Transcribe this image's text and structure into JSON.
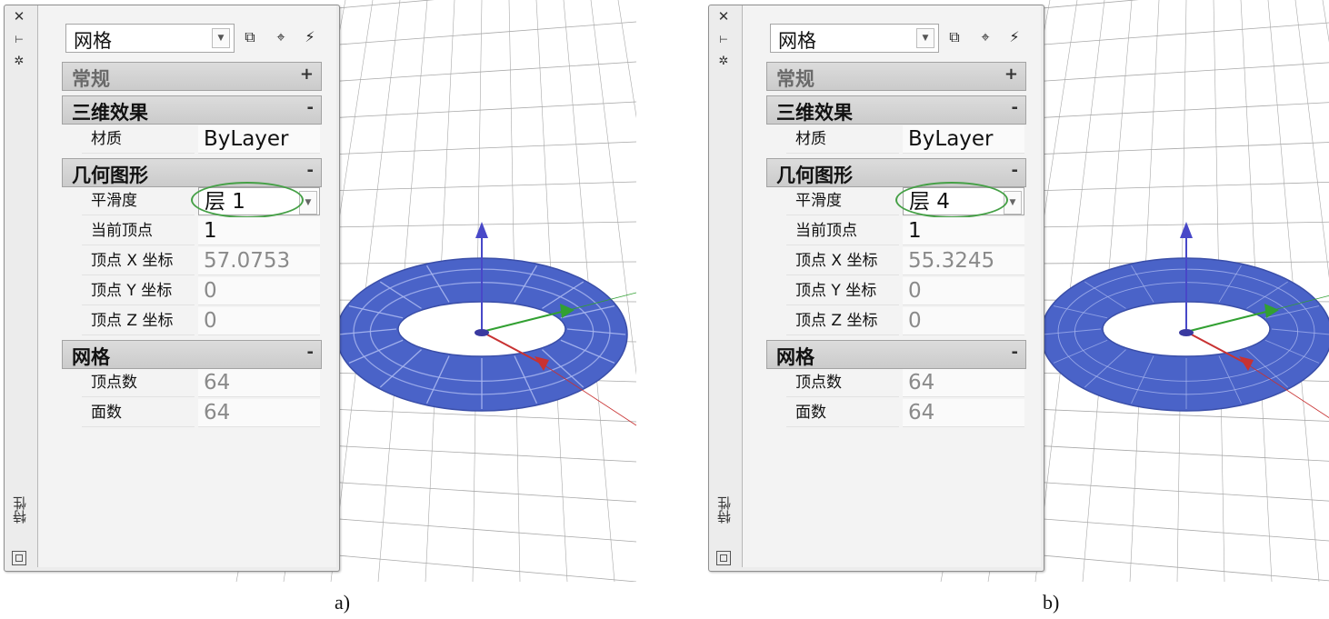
{
  "panels": [
    {
      "id": "a",
      "caption": "a)",
      "window": {
        "title": "特性",
        "object_type": "网格",
        "sections": [
          {
            "title": "常规",
            "toggle": "+",
            "rows": []
          },
          {
            "title": "三维效果",
            "toggle": "-",
            "rows": [
              {
                "label": "材质",
                "value": "ByLayer"
              }
            ]
          },
          {
            "title": "几何图形",
            "toggle": "-",
            "rows": [
              {
                "label": "平滑度",
                "value": "层 1"
              },
              {
                "label": "当前顶点",
                "value": "1"
              },
              {
                "label": "顶点 X 坐标",
                "value": "57.0753"
              },
              {
                "label": "顶点 Y 坐标",
                "value": "0"
              },
              {
                "label": "顶点 Z 坐标",
                "value": "0"
              }
            ]
          },
          {
            "title": "网格",
            "toggle": "-",
            "rows": [
              {
                "label": "顶点数",
                "value": "64"
              },
              {
                "label": "面数",
                "value": "64"
              }
            ]
          }
        ]
      }
    },
    {
      "id": "b",
      "caption": "b)",
      "window": {
        "title": "特性",
        "object_type": "网格",
        "sections": [
          {
            "title": "常规",
            "toggle": "+",
            "rows": []
          },
          {
            "title": "三维效果",
            "toggle": "-",
            "rows": [
              {
                "label": "材质",
                "value": "ByLayer"
              }
            ]
          },
          {
            "title": "几何图形",
            "toggle": "-",
            "rows": [
              {
                "label": "平滑度",
                "value": "层 4"
              },
              {
                "label": "当前顶点",
                "value": "1"
              },
              {
                "label": "顶点 X 坐标",
                "value": "55.3245"
              },
              {
                "label": "顶点 Y 坐标",
                "value": "0"
              },
              {
                "label": "顶点 Z 坐标",
                "value": "0"
              }
            ]
          },
          {
            "title": "网格",
            "toggle": "-",
            "rows": [
              {
                "label": "顶点数",
                "value": "64"
              },
              {
                "label": "面数",
                "value": "64"
              }
            ]
          }
        ]
      }
    }
  ],
  "colors": {
    "mesh_fill": "#4a63c8",
    "mesh_edge": "#aab8f0",
    "axis_z": "#4848c8",
    "axis_x": "#c83232",
    "axis_y": "#32a032",
    "highlight": "#45a046",
    "grid": "#a8a8a8"
  },
  "icons": {
    "close": "close-icon",
    "autohide": "autohide-icon",
    "settings": "settings-icon",
    "toggle_pickadd": "pickadd-icon",
    "select_objects": "select-objects-icon",
    "quick_select": "quick-select-icon"
  }
}
